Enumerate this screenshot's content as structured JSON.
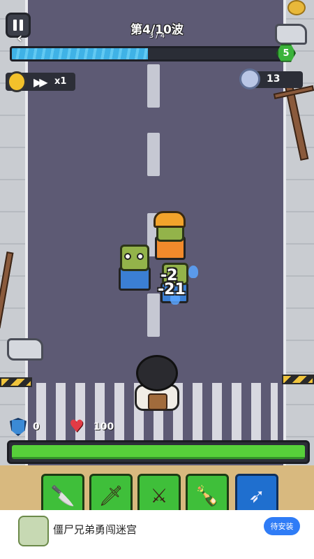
{
  "hud": {
    "wave_title": "第4/10波",
    "wave_subtitle": "3 / 4",
    "wave_progress": 0.5,
    "level_badge": "5",
    "speed_label": "x1",
    "silver_count": "13"
  },
  "combat": {
    "damage_numbers": [
      "-2",
      "-21"
    ]
  },
  "player": {
    "shield_value": "0",
    "health_value": "100",
    "health_progress": 1.0
  },
  "weapons": [
    {
      "name": "knife-icon"
    },
    {
      "name": "dagger-icon"
    },
    {
      "name": "sword-icon"
    },
    {
      "name": "molotov-icon"
    },
    {
      "name": "kunai-icon"
    }
  ],
  "ad": {
    "title": "僵尸兄弟勇闯迷宫",
    "install_label": "待安装"
  },
  "colors": {
    "wave_bar": "#3fb2e6",
    "health_bar": "#57d03a",
    "weapon_slot": "#3fbf3a",
    "weapon_slot_special": "#1f6fcf",
    "install_button": "#2f7cf6"
  }
}
